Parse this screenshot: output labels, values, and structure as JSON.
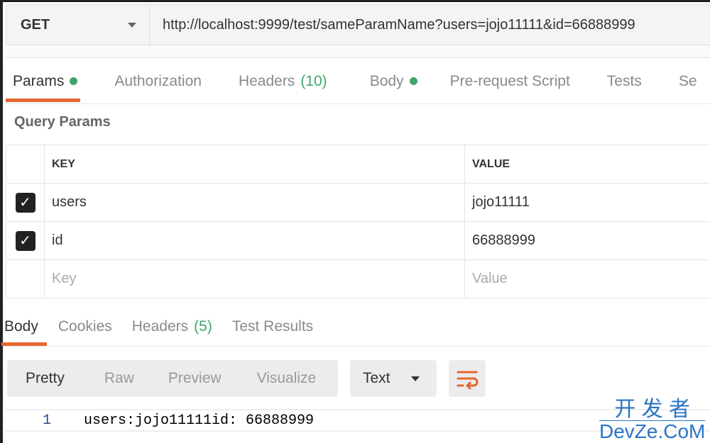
{
  "request": {
    "method": "GET",
    "url": "http://localhost:9999/test/sameParamName?users=jojo11111&id=66888999"
  },
  "request_tabs": [
    {
      "label": "Params",
      "dot": true
    },
    {
      "label": "Authorization"
    },
    {
      "label": "Headers",
      "count": "(10)"
    },
    {
      "label": "Body",
      "dot": true
    },
    {
      "label": "Pre-request Script"
    },
    {
      "label": "Tests"
    },
    {
      "label": "Se"
    }
  ],
  "query_params": {
    "title": "Query Params",
    "headers": [
      "KEY",
      "VALUE"
    ],
    "rows": [
      {
        "checked": true,
        "key": "users",
        "value": "jojo11111"
      },
      {
        "checked": true,
        "key": "id",
        "value": "66888999"
      }
    ],
    "placeholder": {
      "key": "Key",
      "value": "Value"
    }
  },
  "response_tabs": [
    {
      "label": "Body"
    },
    {
      "label": "Cookies"
    },
    {
      "label": "Headers",
      "count": "(5)"
    },
    {
      "label": "Test Results"
    }
  ],
  "view_modes": [
    "Pretty",
    "Raw",
    "Preview",
    "Visualize"
  ],
  "format": "Text",
  "response_body": {
    "line": "1",
    "text": "users:jojo11111id: 66888999"
  },
  "watermark": {
    "line1": "开 发 者",
    "line2": "DevZe.CoM"
  },
  "colors": {
    "accent": "#e8652f",
    "green": "#3fa56b"
  }
}
